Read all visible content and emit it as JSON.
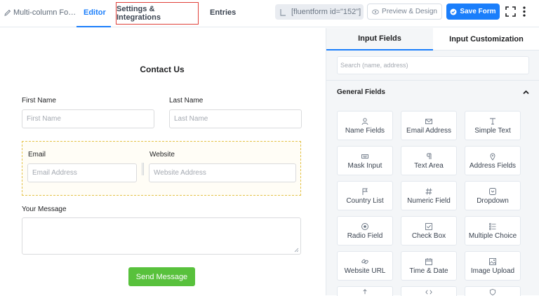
{
  "header": {
    "breadcrumb": "Multi-column Fo…",
    "tabs": {
      "editor": "Editor",
      "settings": "Settings & Integrations",
      "entries": "Entries"
    },
    "shortcode": "[fluentform id=\"152\"]",
    "preview_label": "Preview & Design",
    "save_label": "Save Form",
    "colors": {
      "accent": "#1a7efb",
      "highlight_border": "#e0413a"
    }
  },
  "form": {
    "title": "Contact Us",
    "first_name_label": "First Name",
    "first_name_placeholder": "First Name",
    "last_name_label": "Last Name",
    "last_name_placeholder": "Last Name",
    "email_label": "Email",
    "email_placeholder": "Email Address",
    "website_label": "Website",
    "website_placeholder": "Website Address",
    "message_label": "Your Message",
    "submit_label": "Send Message",
    "colors": {
      "submit": "#58c13c",
      "selected_row_border": "#e4c248"
    }
  },
  "panel": {
    "tabs": {
      "input_fields": "Input Fields",
      "input_customization": "Input Customization"
    },
    "search_placeholder": "Search (name, address)",
    "group_title": "General Fields",
    "fields": [
      {
        "label": "Name Fields",
        "icon": "user-icon"
      },
      {
        "label": "Email Address",
        "icon": "envelope-icon"
      },
      {
        "label": "Simple Text",
        "icon": "text-icon"
      },
      {
        "label": "Mask Input",
        "icon": "keyboard-icon"
      },
      {
        "label": "Text Area",
        "icon": "paragraph-icon"
      },
      {
        "label": "Address Fields",
        "icon": "map-pin-icon"
      },
      {
        "label": "Country List",
        "icon": "flag-icon"
      },
      {
        "label": "Numeric Field",
        "icon": "hash-icon"
      },
      {
        "label": "Dropdown",
        "icon": "dropdown-icon"
      },
      {
        "label": "Radio Field",
        "icon": "radio-icon"
      },
      {
        "label": "Check Box",
        "icon": "checkbox-icon"
      },
      {
        "label": "Multiple Choice",
        "icon": "list-icon"
      },
      {
        "label": "Website URL",
        "icon": "link-icon"
      },
      {
        "label": "Time & Date",
        "icon": "calendar-icon"
      },
      {
        "label": "Image Upload",
        "icon": "image-icon"
      }
    ]
  }
}
